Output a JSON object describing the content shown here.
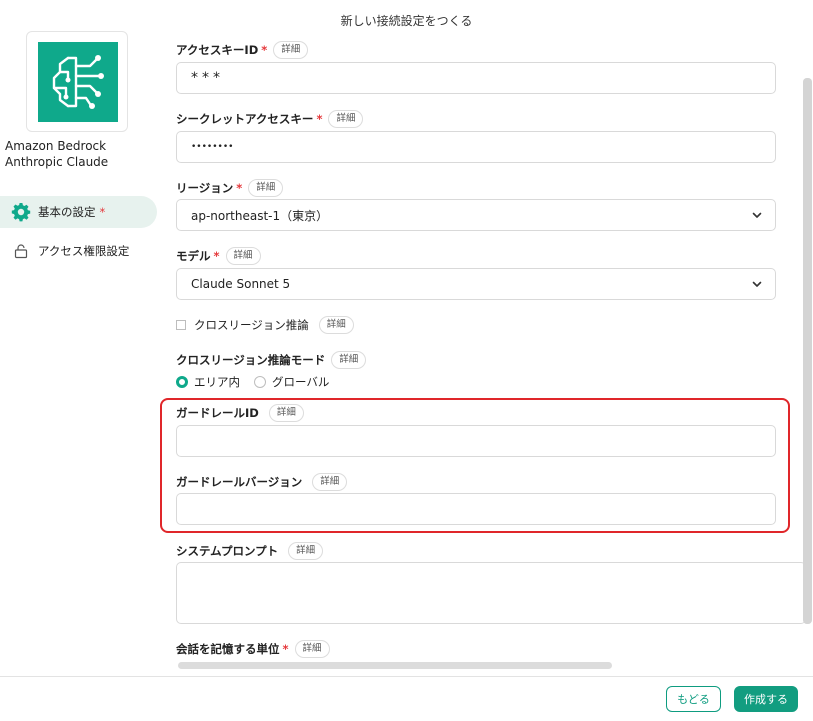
{
  "dialog": {
    "title": "新しい接続設定をつくる"
  },
  "provider": {
    "name_line1": "Amazon Bedrock",
    "name_line2": "Anthropic Claude"
  },
  "sidebar": {
    "items": [
      {
        "label": "基本の設定",
        "required_mark": "*",
        "active": true,
        "icon": "gear-icon"
      },
      {
        "label": "アクセス権限設定",
        "active": false,
        "icon": "lock-icon"
      }
    ]
  },
  "form": {
    "detail_chip": "詳細",
    "required_mark": "*",
    "access_key_id": {
      "label": "アクセスキーID",
      "value": "***"
    },
    "secret_access_key": {
      "label": "シークレットアクセスキー",
      "value": "••••••••"
    },
    "region": {
      "label": "リージョン",
      "value": "ap-northeast-1（東京）"
    },
    "model": {
      "label": "モデル",
      "value": "Claude Sonnet 5"
    },
    "cross_region": {
      "label": "クロスリージョン推論",
      "checked": false
    },
    "cross_region_mode": {
      "label": "クロスリージョン推論モード",
      "options": [
        {
          "label": "エリア内",
          "selected": true
        },
        {
          "label": "グローバル",
          "selected": false
        }
      ]
    },
    "guardrail_id": {
      "label": "ガードレールID",
      "value": ""
    },
    "guardrail_version": {
      "label": "ガードレールバージョン",
      "value": ""
    },
    "system_prompt": {
      "label": "システムプロンプト",
      "value": ""
    },
    "memory_unit": {
      "label": "会話を記憶する単位"
    }
  },
  "footer": {
    "back_label": "もどる",
    "create_label": "作成する"
  },
  "colors": {
    "accent": "#0fa98b",
    "required": "#e5383b",
    "highlight": "#e0262a"
  }
}
